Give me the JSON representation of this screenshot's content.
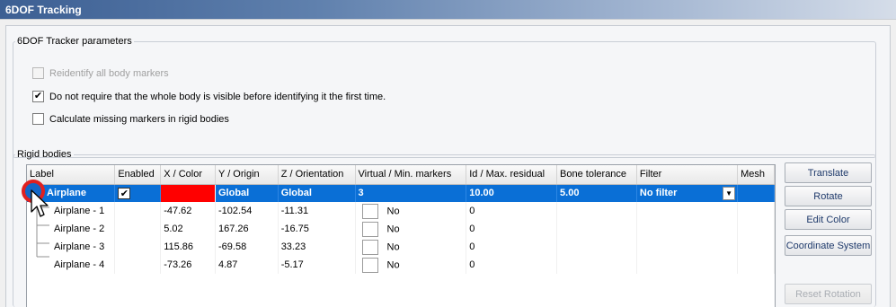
{
  "panel": {
    "title": "6DOF Tracking"
  },
  "params": {
    "legend": "6DOF Tracker parameters",
    "options": [
      {
        "label": "Reidentify all body markers",
        "checked": false,
        "enabled": false
      },
      {
        "label": "Do not require that the whole body is visible before identifying it the first time.",
        "checked": true,
        "enabled": true
      },
      {
        "label": "Calculate missing markers in rigid bodies",
        "checked": false,
        "enabled": true
      }
    ]
  },
  "rigid": {
    "legend": "Rigid bodies",
    "columns": [
      "Label",
      "Enabled",
      "X / Color",
      "Y / Origin",
      "Z / Orientation",
      "Virtual / Min. markers",
      "Id / Max. residual",
      "Bone tolerance",
      "Filter",
      "Mesh"
    ],
    "body": {
      "label": "Airplane",
      "enabled": true,
      "color": "#ff0000",
      "origin": "Global",
      "orientation": "Global",
      "min_markers": "3",
      "max_residual": "10.00",
      "bone_tolerance": "5.00",
      "filter": "No filter"
    },
    "markers": [
      {
        "label": "Airplane - 1",
        "x": "-47.62",
        "y": "-102.54",
        "z": "-11.31",
        "virtual": "No",
        "id": "0"
      },
      {
        "label": "Airplane - 2",
        "x": "5.02",
        "y": "167.26",
        "z": "-16.75",
        "virtual": "No",
        "id": "0"
      },
      {
        "label": "Airplane - 3",
        "x": "115.86",
        "y": "-69.58",
        "z": "33.23",
        "virtual": "No",
        "id": "0"
      },
      {
        "label": "Airplane - 4",
        "x": "-73.26",
        "y": "4.87",
        "z": "-5.17",
        "virtual": "No",
        "id": "0"
      }
    ]
  },
  "buttons": {
    "translate": "Translate",
    "rotate": "Rotate",
    "edit_color": "Edit Color",
    "coordinate_system": "Coordinate System",
    "reset_rotation": "Reset Rotation"
  }
}
